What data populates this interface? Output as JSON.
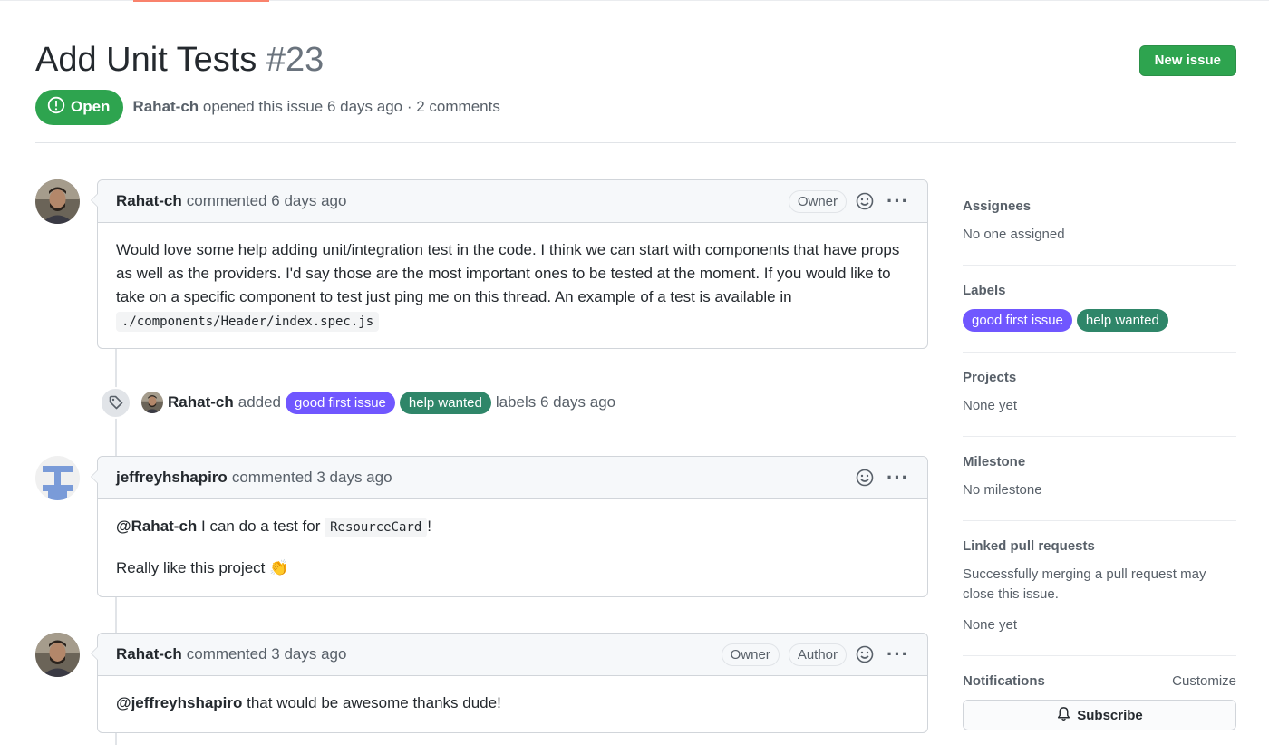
{
  "issue": {
    "title": "Add Unit Tests",
    "number": "#23",
    "state": "Open",
    "author": "Rahat-ch",
    "meta_suffix": "opened this issue 6 days ago · 2 comments",
    "new_issue_label": "New issue"
  },
  "comments": [
    {
      "author": "Rahat-ch",
      "time": "commented 6 days ago",
      "badges": [
        "Owner"
      ],
      "body_text": "Would love some help adding unit/integration test in the code. I think we can start with components that have props as well as the providers. I'd say those are the most important ones to be tested at the moment. If you would like to take on a specific component to test just ping me on this thread. An example of a test is available in ",
      "body_code": "./components/Header/index.spec.js"
    },
    {
      "author": "jeffreyhshapiro",
      "time": "commented 3 days ago",
      "badges": [],
      "mention": "@Rahat-ch",
      "line1_text": " I can do a test for ",
      "line1_code": "ResourceCard",
      "line1_end": "!",
      "line2_text": "Really like this project ",
      "line2_emoji": "👏"
    },
    {
      "author": "Rahat-ch",
      "time": "commented 3 days ago",
      "badges": [
        "Owner",
        "Author"
      ],
      "mention": "@jeffreyhshapiro",
      "body_text": " that would be awesome thanks dude!"
    }
  ],
  "event": {
    "author": "Rahat-ch",
    "action": "added",
    "labels": [
      "good first issue",
      "help wanted"
    ],
    "suffix": "labels 6 days ago"
  },
  "labels": {
    "good_first_issue": {
      "name": "good first issue",
      "color": "#7057ff"
    },
    "help_wanted": {
      "name": "help wanted",
      "color": "#2f8669"
    }
  },
  "sidebar": {
    "assignees": {
      "heading": "Assignees",
      "value": "No one assigned"
    },
    "labels": {
      "heading": "Labels",
      "items": [
        "good first issue",
        "help wanted"
      ]
    },
    "projects": {
      "heading": "Projects",
      "value": "None yet"
    },
    "milestone": {
      "heading": "Milestone",
      "value": "No milestone"
    },
    "linked_prs": {
      "heading": "Linked pull requests",
      "description": "Successfully merging a pull request may close this issue.",
      "value": "None yet"
    },
    "notifications": {
      "heading": "Notifications",
      "customize": "Customize",
      "subscribe": "Subscribe"
    }
  },
  "colors": {
    "open_green": "#2ea44f",
    "accent_orange": "#f9826c"
  }
}
